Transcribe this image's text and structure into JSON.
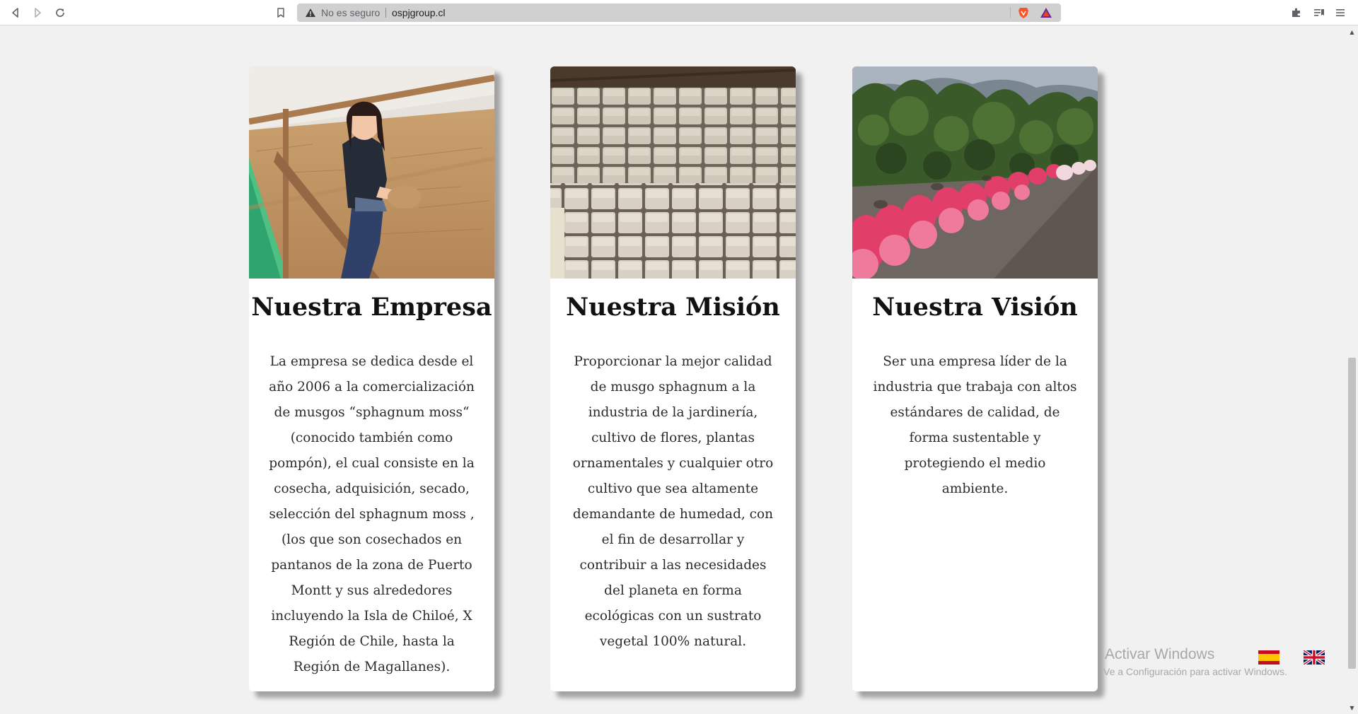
{
  "browser": {
    "security_label": "No es seguro",
    "url": "ospjgroup.cl"
  },
  "cards": [
    {
      "title": "Nuestra Empresa",
      "body": "La empresa se dedica desde el año 2006 a la comercialización de musgos “sphagnum moss“ (conocido también como pompón), el cual consiste en la cosecha, adquisición, secado, selección del sphagnum moss , (los que son cosechados en pantanos de la zona de Puerto Montt y sus alrededores incluyendo la Isla de Chiloé, X Región de Chile, hasta la Región de Magallanes)."
    },
    {
      "title": "Nuestra Misión",
      "body": "Proporcionar la mejor calidad de musgo sphagnum a la industria de la jardinería, cultivo de flores, plantas ornamentales y cualquier otro cultivo que sea altamente demandante de humedad, con el fin de desarrollar y contribuir a las necesidades del planeta en forma ecológicas con un sustrato vegetal 100% natural."
    },
    {
      "title": "Nuestra Visión",
      "body": "Ser una empresa líder de la industria que trabaja con altos estándares de calidad, de forma sustentable y protegiendo el medio ambiente."
    }
  ],
  "watermark": {
    "title": "Activar Windows",
    "subtitle": "Ve a Configuración para activar Windows."
  },
  "icons": {
    "back": "back-arrow-icon",
    "forward": "forward-arrow-icon",
    "reload": "reload-icon",
    "bookmark": "bookmark-icon",
    "warning": "warning-icon",
    "brave": "brave-lion-icon",
    "rewards": "rewards-triangle-icon",
    "extensions": "puzzle-icon",
    "reading_list": "reading-list-icon",
    "menu": "hamburger-menu-icon",
    "flag_es": "spain-flag-icon",
    "flag_en": "uk-flag-icon"
  },
  "colors": {
    "page_bg": "#f1f1f1",
    "card_bg": "#ffffff",
    "brave_orange": "#fb542b",
    "rewards_purple": "#662d91"
  }
}
